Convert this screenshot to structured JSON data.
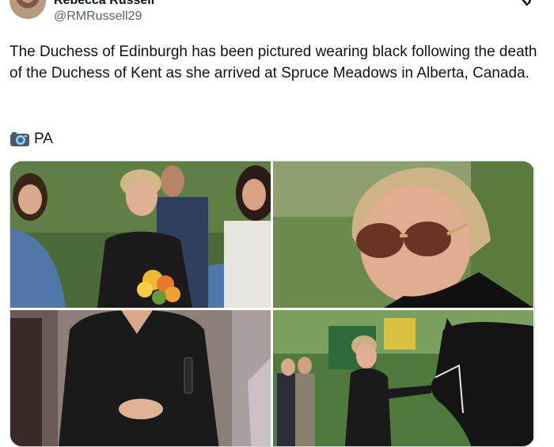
{
  "author": {
    "display_name": "Rebecca Russell",
    "handle": "@RMRussell29"
  },
  "tweet": {
    "text": "The Duchess of Edinburgh has been pictured wearing black following the death of the Duchess of Kent as she arrived at Spruce Meadows in Alberta, Canada.",
    "credit": "PA"
  },
  "icons": {
    "top_right": "grok-icon",
    "credit": "camera-icon"
  },
  "media_count": 4
}
